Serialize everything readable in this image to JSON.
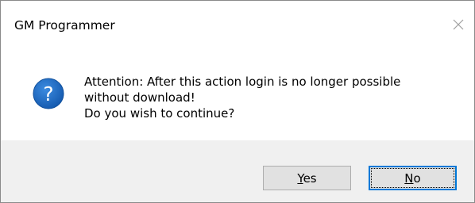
{
  "window": {
    "title": "GM Programmer",
    "close_icon": "close-icon"
  },
  "dialog": {
    "icon": "question-icon",
    "icon_glyph": "?",
    "icon_color": "#1e68c1",
    "message_lines": [
      "Attention: After this action login is no longer possible",
      "without download!",
      "Do you wish to continue?"
    ]
  },
  "buttons": {
    "yes": {
      "label_mnemonic": "Y",
      "label_rest": "es"
    },
    "no": {
      "label_mnemonic": "N",
      "label_rest": "o",
      "focused": true
    }
  },
  "colors": {
    "footer_bg": "#f0f0f0",
    "button_bg": "#e1e1e1",
    "focus_border": "#0078d7"
  }
}
